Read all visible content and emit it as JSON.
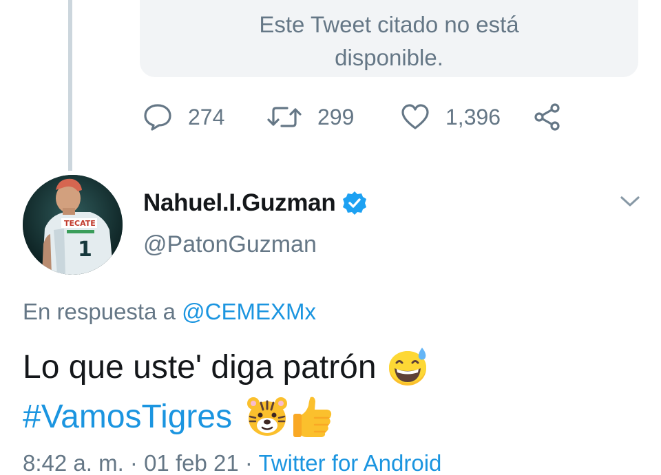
{
  "quoted": {
    "unavailable_text": "Este Tweet citado no está disponible."
  },
  "actions": {
    "replies": "274",
    "retweets": "299",
    "likes": "1,396"
  },
  "author": {
    "display_name": "Nahuel.I.Guzman",
    "handle": "@PatonGuzman",
    "verified": true,
    "jersey_text": "TECATE",
    "jersey_number": "1"
  },
  "reply_to": {
    "prefix": "En respuesta a ",
    "mention": "@CEMEXMx"
  },
  "tweet": {
    "text": "Lo que uste' diga patrón",
    "hashtag": "#VamosTigres",
    "emojis": [
      "grinning-sweat-emoji",
      "tiger-face-emoji",
      "thumbs-up-emoji"
    ]
  },
  "meta": {
    "time": "8:42 a. m.",
    "separator": " · ",
    "date": "01 feb 21",
    "source": "Twitter for Android"
  },
  "colors": {
    "link": "#1b95e0",
    "secondary": "#657786",
    "verified": "#1da1f2",
    "thread": "#ccd6dd"
  }
}
